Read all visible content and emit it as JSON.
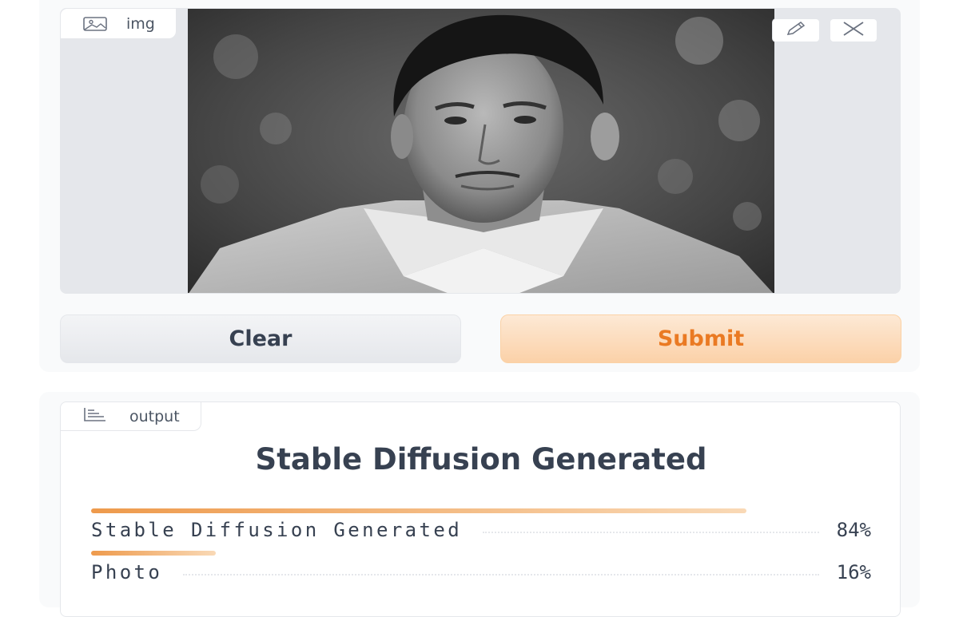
{
  "input": {
    "label": "img",
    "label_icon": "image-icon",
    "tools": {
      "edit_icon": "pencil-icon",
      "close_icon": "close-icon"
    }
  },
  "buttons": {
    "clear_label": "Clear",
    "submit_label": "Submit"
  },
  "output": {
    "label": "output",
    "label_icon": "bar-chart-icon",
    "title": "Stable Diffusion Generated",
    "confidences": [
      {
        "label": "Stable Diffusion Generated",
        "value": "84%",
        "fraction": 0.84
      },
      {
        "label": "Photo",
        "value": "16%",
        "fraction": 0.16
      }
    ]
  },
  "colors": {
    "accent": "#ea7a23",
    "bar_start": "#ee9a4c",
    "bar_end": "#f9d9b6",
    "panel_bg": "#f9fafb",
    "border": "#e5e7eb"
  }
}
